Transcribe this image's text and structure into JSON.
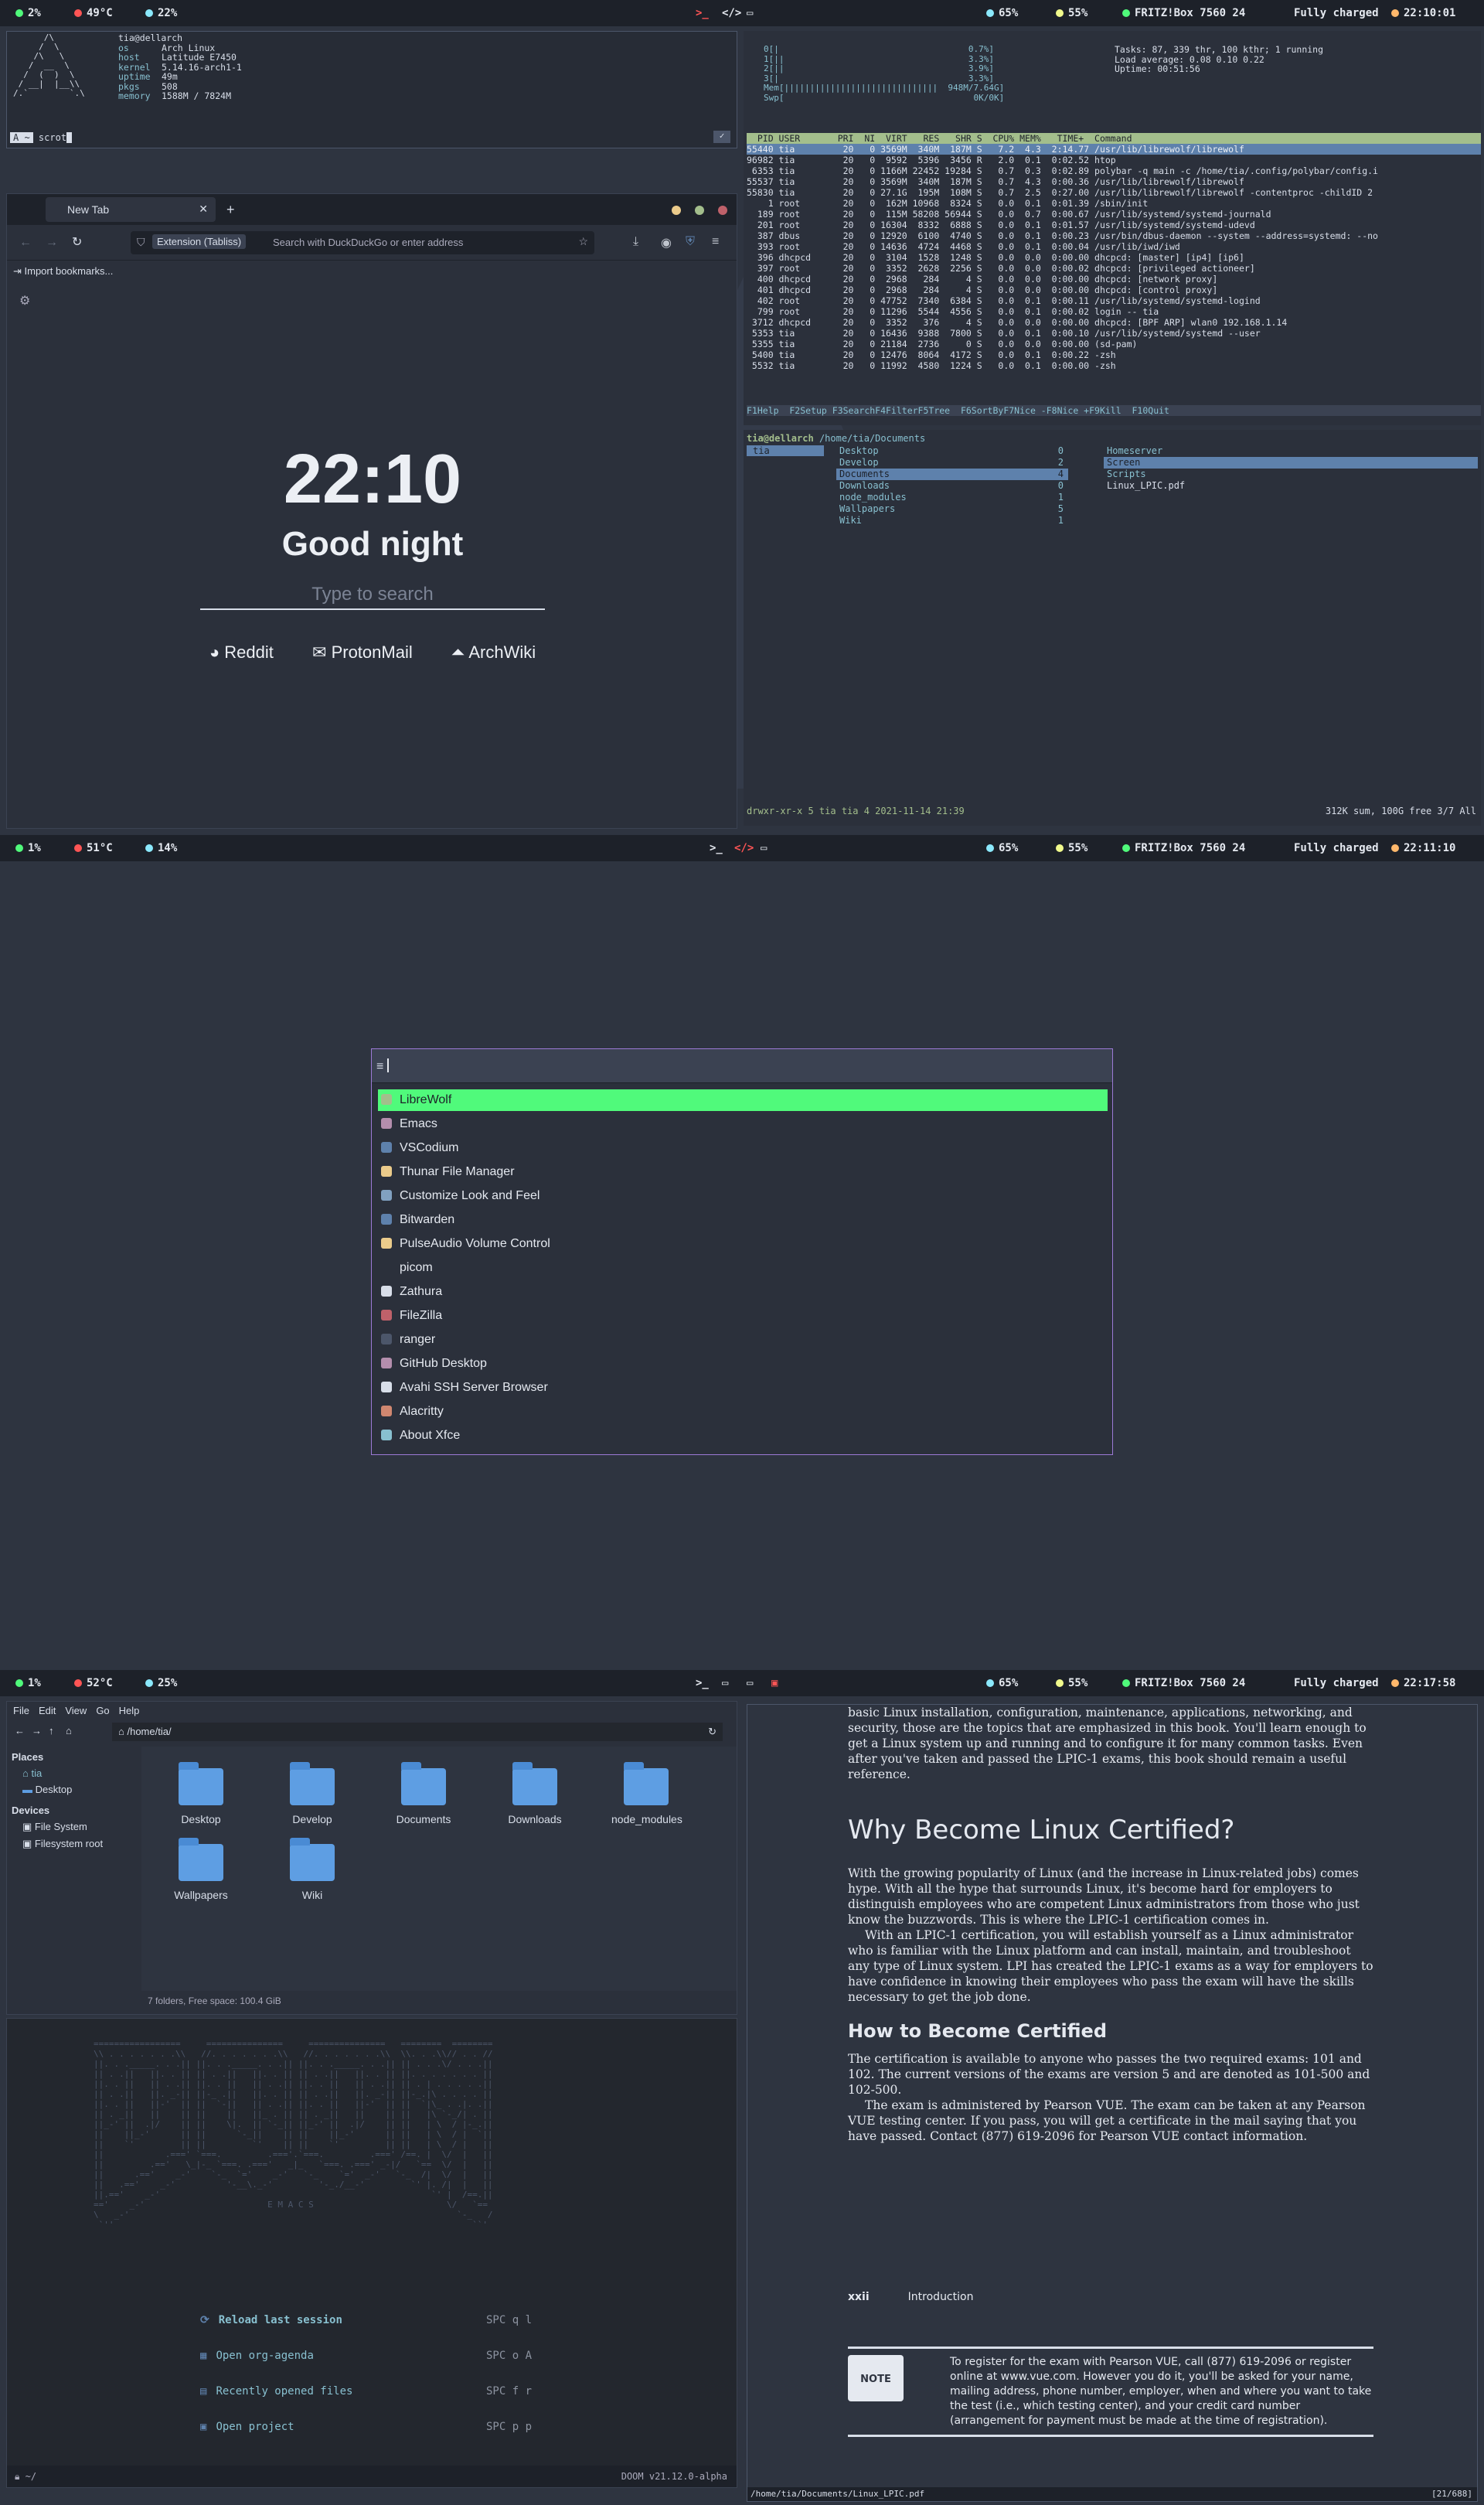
{
  "colors": {
    "bg": "#2e3440",
    "bar": "#1d2129",
    "accent_green": "#50fa7b",
    "accent_purple": "#9c7ad6",
    "accent_red": "#bf616a"
  },
  "screen1": {
    "bar": {
      "cpu": "2%",
      "temp": "49°C",
      "mem": "22%",
      "vol": "65%",
      "bright": "55%",
      "wifi": "FRITZ!Box 7560 24",
      "battery": "Fully charged",
      "time": "22:10:01"
    },
    "neofetch": {
      "user": "tia@dellarch",
      "os_label": "os",
      "os": "Arch Linux",
      "host_label": "host",
      "host": "Latitude E7450",
      "kernel_label": "kernel",
      "kernel": "5.14.16-arch1-1",
      "uptime_label": "uptime",
      "uptime": "49m",
      "pkgs_label": "pkgs",
      "pkgs": "508",
      "memory_label": "memory",
      "memory": "1588M / 7824M",
      "prompt": "scrot"
    },
    "browser": {
      "tab": "New Tab",
      "url_ext": "Extension (Tabliss)",
      "url_placeholder": "Search with DuckDuckGo or enter address",
      "bookmarks": "Import bookmarks...",
      "clock": "22:10",
      "greeting": "Good night",
      "search_placeholder": "Type to search",
      "links": [
        "Reddit",
        "ProtonMail",
        "ArchWiki"
      ]
    },
    "htop": {
      "summary": [
        "Tasks: 87, 339 thr, 100 kthr; 1 running",
        "Load average: 0.08 0.10 0.22",
        "Uptime: 00:51:56"
      ],
      "header": "  PID USER       PRI  NI  VIRT   RES   SHR S  CPU% MEM%   TIME+  Command",
      "rows": [
        "55440 tia         20   0 3569M  340M  187M S   7.2  4.3  2:14.77 /usr/lib/librewolf/librewolf",
        "96982 tia         20   0  9592  5396  3456 R   2.0  0.1  0:02.52 htop",
        " 6353 tia         20   0 1166M 22452 19284 S   0.7  0.3  0:02.89 polybar -q main -c /home/tia/.config/polybar/config.i",
        "55537 tia         20   0 3569M  340M  187M S   0.7  4.3  0:00.36 /usr/lib/librewolf/librewolf",
        "55830 tia         20   0 27.1G  195M  108M S   0.7  2.5  0:27.00 /usr/lib/librewolf/librewolf -contentproc -childID 2",
        "    1 root        20   0  162M 10968  8324 S   0.0  0.1  0:01.39 /sbin/init",
        "  189 root        20   0  115M 58208 56944 S   0.0  0.7  0:00.67 /usr/lib/systemd/systemd-journald",
        "  201 root        20   0 16304  8332  6888 S   0.0  0.1  0:01.57 /usr/lib/systemd/systemd-udevd",
        "  387 dbus        20   0 12920  6100  4740 S   0.0  0.1  0:00.23 /usr/bin/dbus-daemon --system --address=systemd: --no",
        "  393 root        20   0 14636  4724  4468 S   0.0  0.1  0:00.04 /usr/lib/iwd/iwd",
        "  396 dhcpcd      20   0  3104  1528  1248 S   0.0  0.0  0:00.00 dhcpcd: [master] [ip4] [ip6]",
        "  397 root        20   0  3352  2628  2256 S   0.0  0.0  0:00.02 dhcpcd: [privileged actioneer]",
        "  400 dhcpcd      20   0  2968   284     4 S   0.0  0.0  0:00.00 dhcpcd: [network proxy]",
        "  401 dhcpcd      20   0  2968   284     4 S   0.0  0.0  0:00.00 dhcpcd: [control proxy]",
        "  402 root        20   0 47752  7340  6384 S   0.0  0.1  0:00.11 /usr/lib/systemd/systemd-logind",
        "  799 root        20   0 11296  5544  4556 S   0.0  0.1  0:00.02 login -- tia",
        " 3712 dhcpcd      20   0  3352   376     4 S   0.0  0.0  0:00.00 dhcpcd: [BPF ARP] wlan0 192.168.1.14",
        " 5353 tia         20   0 16436  9388  7800 S   0.0  0.1  0:00.10 /usr/lib/systemd/systemd --user",
        " 5355 tia         20   0 21184  2736     0 S   0.0  0.0  0:00.00 (sd-pam)",
        " 5400 tia         20   0 12476  8064  4172 S   0.0  0.1  0:00.22 -zsh",
        " 5532 tia         20   0 11992  4580  1224 S   0.0  0.1  0:00.00 -zsh"
      ],
      "fkeys": "F1Help  F2Setup F3SearchF4FilterF5Tree  F6SortByF7Nice -F8Nice +F9Kill  F10Quit"
    },
    "ranger": {
      "path_user": "tia@dellarch",
      "path": "/home/tia/Documents",
      "col1": [
        "tia"
      ],
      "col2": [
        [
          "Desktop",
          "0"
        ],
        [
          "Develop",
          "2"
        ],
        [
          "Documents",
          "4"
        ],
        [
          "Downloads",
          "0"
        ],
        [
          "node_modules",
          "1"
        ],
        [
          "Wallpapers",
          "5"
        ],
        [
          "Wiki",
          "1"
        ]
      ],
      "col3": [
        "Homeserver",
        "Screen",
        "Scripts",
        "Linux_LPIC.pdf"
      ],
      "status": "drwxr-xr-x 5 tia tia 4 2021-11-14 21:39",
      "status_right": "312K sum, 100G free  3/7  All"
    }
  },
  "screen2": {
    "bar": {
      "cpu": "1%",
      "temp": "51°C",
      "mem": "14%",
      "vol": "65%",
      "bright": "55%",
      "wifi": "FRITZ!Box 7560 24",
      "battery": "Fully charged",
      "time": "22:11:10"
    },
    "apps": [
      "LibreWolf",
      "Emacs",
      "VSCodium",
      "Thunar File Manager",
      "Customize Look and Feel",
      "Bitwarden",
      "PulseAudio Volume Control",
      "picom",
      "Zathura",
      "FileZilla",
      "ranger",
      "GitHub Desktop",
      "Avahi SSH Server Browser",
      "Alacritty",
      "About Xfce"
    ]
  },
  "screen3": {
    "bar": {
      "cpu": "1%",
      "temp": "52°C",
      "mem": "25%",
      "vol": "65%",
      "bright": "55%",
      "wifi": "FRITZ!Box 7560 24",
      "battery": "Fully charged",
      "time": "22:17:58"
    },
    "thunar": {
      "menu": [
        "File",
        "Edit",
        "View",
        "Go",
        "Help"
      ],
      "path": "/home/tia/",
      "places_title": "Places",
      "places": [
        "tia",
        "Desktop"
      ],
      "devices_title": "Devices",
      "devices": [
        "File System",
        "Filesystem root"
      ],
      "folders": [
        "Desktop",
        "Develop",
        "Documents",
        "Downloads",
        "node_modules",
        "Wallpapers",
        "Wiki"
      ],
      "status": "7 folders, Free space: 100.4 GiB"
    },
    "emacs": {
      "banner": "E M A C S",
      "items": [
        [
          "Reload last session",
          "SPC q l"
        ],
        [
          "Open org-agenda",
          "SPC o A"
        ],
        [
          "Recently opened files",
          "SPC f r"
        ],
        [
          "Open project",
          "SPC p p"
        ]
      ],
      "modeline_left": "~/",
      "modeline_right": "DOOM v21.12.0-alpha"
    },
    "pdf": {
      "intro": "basic Linux installation, configuration, maintenance, applications, networking, and security, those are the topics that are emphasized in this book. You'll learn enough to get a Linux system up and running and to configure it for many common tasks. Even after you've taken and passed the LPIC-1 exams, this book should remain a useful reference.",
      "h1": "Why Become Linux Certified?",
      "p1": "With the growing popularity of Linux (and the increase in Linux-related jobs) comes hype. With all the hype that surrounds Linux, it's become hard for employers to distinguish employees who are competent Linux administrators from those who just know the buzzwords. This is where the LPIC-1 certification comes in.",
      "p2": "With an LPIC-1 certification, you will establish yourself as a Linux administrator who is familiar with the Linux platform and can install, maintain, and troubleshoot any type of Linux system. LPI has created the LPIC-1 exams as a way for employers to have confidence in knowing their employees who pass the exam will have the skills necessary to get the job done.",
      "h2": "How to Become Certified",
      "p3": "The certification is available to anyone who passes the two required exams: 101 and 102. The current versions of the exams are version 5 and are denoted as 101-500 and 102-500.",
      "p4": "The exam is administered by Pearson VUE. The exam can be taken at any Pearson VUE testing center. If you pass, you will get a certificate in the mail saying that you have passed. Contact (877) 619-2096 for Pearson VUE contact information.",
      "page_num": "xxii",
      "page_title": "Introduction",
      "note_label": "NOTE",
      "note": "To register for the exam with Pearson VUE, call (877) 619-2096 or register online at www.vue.com. However you do it, you'll be asked for your name, mailing address, phone number, employer, when and where you want to take the test (i.e., which testing center), and your credit card number (arrangement for payment must be made at the time of registration).",
      "bottom_path": "/home/tia/Documents/Linux_LPIC.pdf",
      "bottom_right": "[21/688]"
    }
  }
}
